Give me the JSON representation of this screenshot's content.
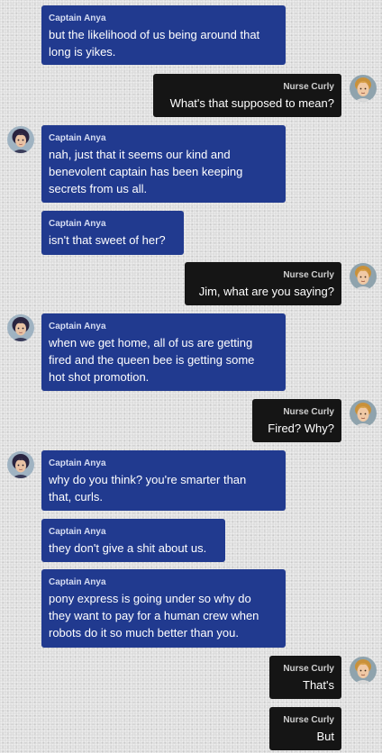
{
  "chat": {
    "messages": [
      {
        "sender": "Captain Anya",
        "text": "but the likelihood of us being around that\nlong is yikes."
      },
      {
        "sender": "Nurse Curly",
        "text": "What's that supposed to mean?"
      },
      {
        "sender": "Captain Anya",
        "text": "nah, just that it seems our kind and\nbenevolent captain has been keeping\nsecrets from us all."
      },
      {
        "sender": "Captain Anya",
        "text": "isn't that sweet of her?"
      },
      {
        "sender": "Nurse Curly",
        "text": "Jim, what are you saying?"
      },
      {
        "sender": "Captain Anya",
        "text": "when we get home, all of us are getting\nfired and the queen bee is getting some\nhot shot promotion."
      },
      {
        "sender": "Nurse Curly",
        "text": "Fired? Why?"
      },
      {
        "sender": "Captain Anya",
        "text": "why do you think? you're smarter than\nthat, curls."
      },
      {
        "sender": "Captain Anya",
        "text": "they don't give a shit about us."
      },
      {
        "sender": "Captain Anya",
        "text": "pony express is going under so why do\nthey want to pay for a human crew when\nrobots do it so much better than you."
      },
      {
        "sender": "Nurse Curly",
        "text": "That's"
      },
      {
        "sender": "Nurse Curly",
        "text": "But"
      }
    ]
  },
  "avatars": {
    "captain": "avatar-captain-anya",
    "nurse": "avatar-nurse-curly"
  },
  "colors": {
    "left_bubble": "#213a8f",
    "right_bubble": "#151515",
    "background": "#dcdcdc"
  }
}
